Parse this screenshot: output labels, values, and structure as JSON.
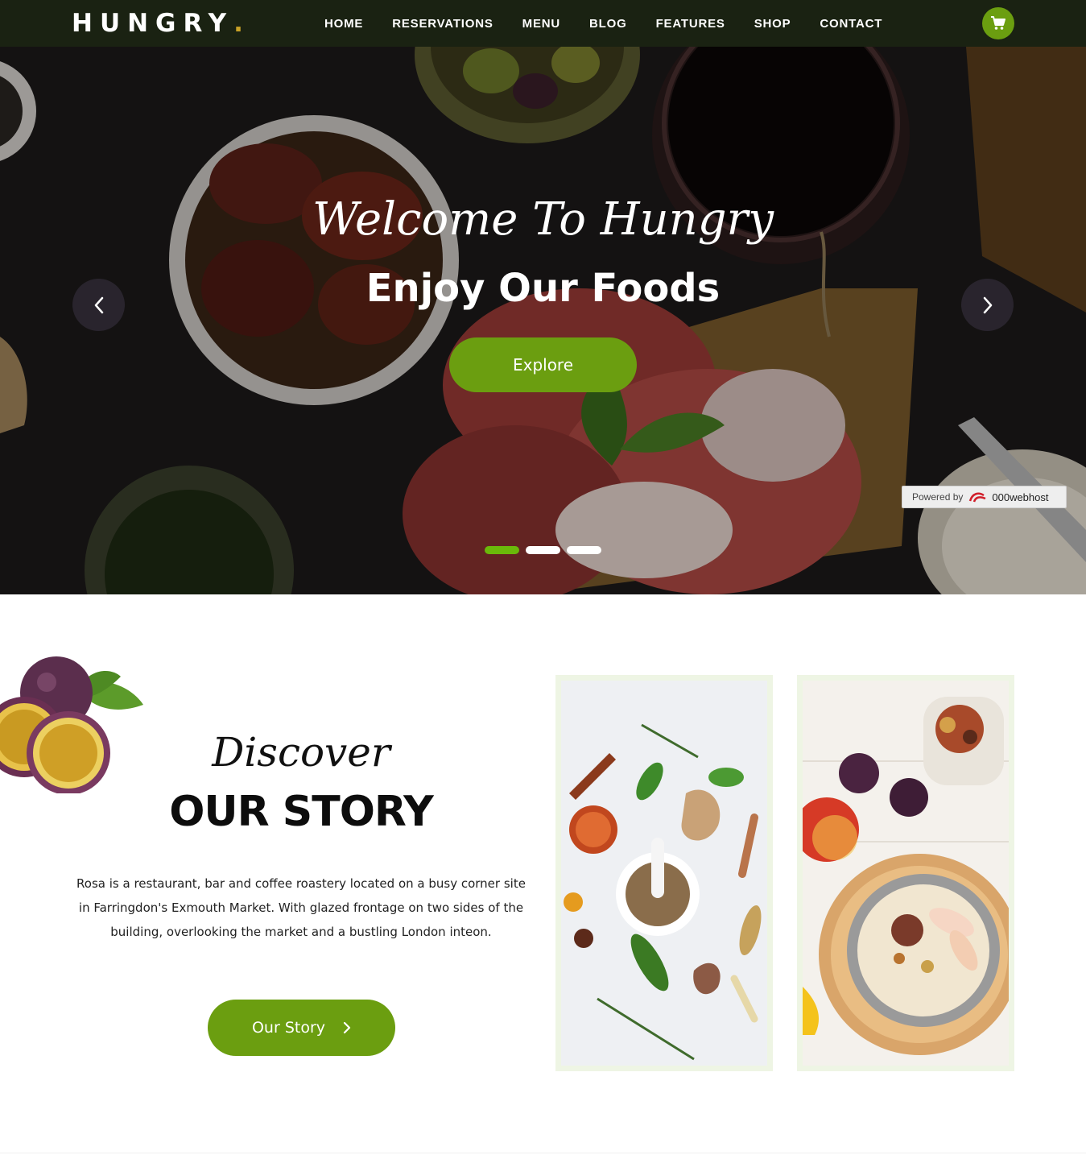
{
  "brand": {
    "name": "HUNGRY",
    "dot": ".",
    "accent": "#6b9e10",
    "dot_color": "#c9a227"
  },
  "nav": {
    "items": [
      {
        "label": "HOME"
      },
      {
        "label": "RESERVATIONS"
      },
      {
        "label": "MENU"
      },
      {
        "label": "BLOG"
      },
      {
        "label": "FEATURES"
      },
      {
        "label": "SHOP"
      },
      {
        "label": "CONTACT"
      }
    ],
    "cart_icon": "shopping-cart-icon"
  },
  "hero": {
    "script_text": "Welcome To Hungry",
    "title": "Enjoy Our Foods",
    "button_label": "Explore",
    "prev_icon": "chevron-left-icon",
    "next_icon": "chevron-right-icon",
    "slides_total": 3,
    "active_slide": 1,
    "powered": {
      "prefix": "Powered by",
      "brand": "000webhost"
    }
  },
  "story": {
    "script_text": "Discover",
    "title": "OUR STORY",
    "description": "Rosa is a restaurant, bar and coffee roastery located on a busy corner site in Farringdon's Exmouth Market. With glazed frontage on two sides of the building, overlooking the market and a bustling London inteon.",
    "button_label": "Our Story",
    "button_icon": "chevron-right-icon"
  }
}
